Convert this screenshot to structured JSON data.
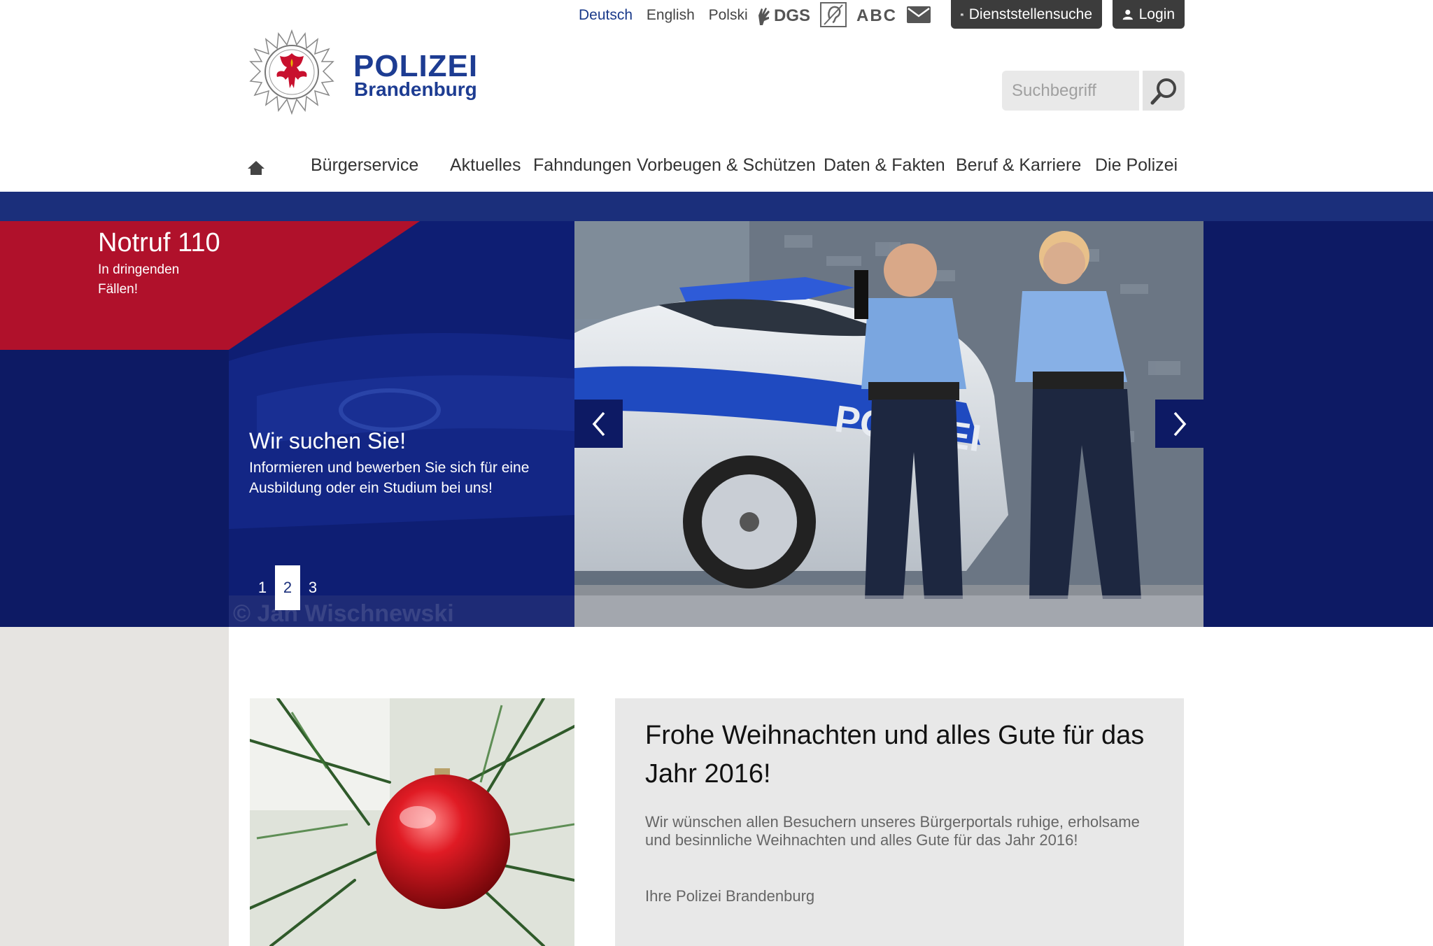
{
  "languages": [
    {
      "label": "Deutsch",
      "active": true
    },
    {
      "label": "English",
      "active": false
    },
    {
      "label": "Polski",
      "active": false
    }
  ],
  "accessibility": {
    "dgs_label": "DGS",
    "abc_label": "ABC"
  },
  "top_buttons": {
    "dienststellen": "Dienststellensuche",
    "login": "Login"
  },
  "logo": {
    "line1": "POLIZEI",
    "line2": "Brandenburg"
  },
  "search": {
    "placeholder": "Suchbegriff"
  },
  "nav": {
    "items": [
      "Bürgerservice",
      "Aktuelles",
      "Fahndungen",
      "Vorbeugen & Schützen",
      "Daten & Fakten",
      "Beruf & Karriere",
      "Die Polizei"
    ]
  },
  "notruf": {
    "title": "Notruf 110",
    "subtitle": "In dringenden Fällen!"
  },
  "slider": {
    "title": "Wir suchen Sie!",
    "text": "Informieren und bewerben Sie sich für eine Ausbildung oder ein Studium bei uns!",
    "pages": [
      "1",
      "2",
      "3"
    ],
    "active_page": "2",
    "credit": "© Jan Wischnewski",
    "car_label": "POLIZEI"
  },
  "news": {
    "title": "Frohe Weihnachten und alles Gute für das Jahr 2016!",
    "body": "Wir wünschen allen Besuchern unseres Bürgerportals ruhige, erholsame und besinnliche Weihnachten und alles Gute für das Jahr 2016!",
    "signature": "Ihre Polizei Brandenburg"
  },
  "colors": {
    "brand_blue": "#1d3c92",
    "hero_navy": "#0d1a64",
    "stripe": "#1b2f7b",
    "notruf_red": "#b0112b"
  }
}
